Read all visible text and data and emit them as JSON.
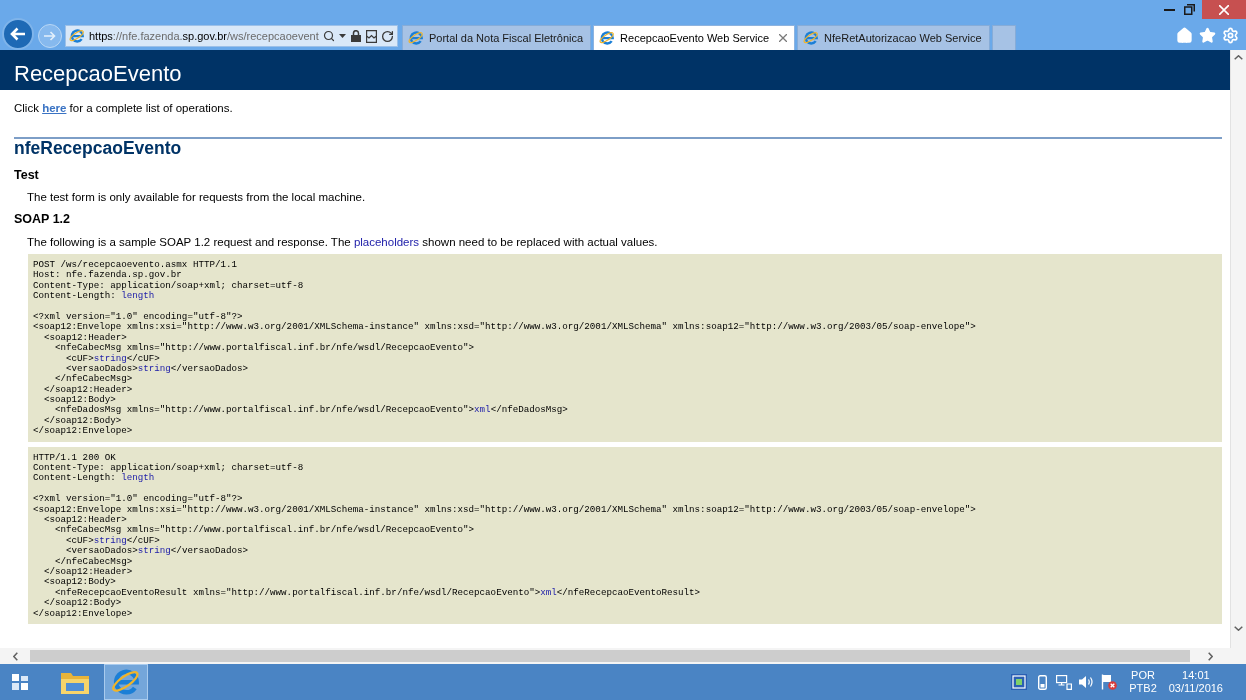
{
  "browser": {
    "address": [
      {
        "text": "https",
        "emphasis": true
      },
      {
        "text": "://nfe.fazenda.",
        "emphasis": false
      },
      {
        "text": "sp.gov.br",
        "emphasis": true
      },
      {
        "text": "/ws/recepcaoevent",
        "emphasis": false
      }
    ],
    "tabs": [
      {
        "label": "Portal da Nota Fiscal Eletrônica",
        "selected": false
      },
      {
        "label": "RecepcaoEvento Web Service",
        "selected": true
      },
      {
        "label": "NfeRetAutorizacao Web Service",
        "selected": false
      }
    ]
  },
  "page": {
    "title": "RecepcaoEvento",
    "operations_note": {
      "before": "Click ",
      "link": "here",
      "after": " for a complete list of operations."
    },
    "operation": "nfeRecepcaoEvento",
    "test": {
      "heading": "Test",
      "note": "The test form is only available for requests from the local machine."
    },
    "soap12": {
      "heading": "SOAP 1.2",
      "note": {
        "before": "The following is a sample SOAP 1.2 request and response. The ",
        "highlight": "placeholders",
        "after": " shown need to be replaced with actual values."
      },
      "samples": [
        {
          "headers": [
            [
              {
                "text": "POST /ws/recepcaoevento.asmx HTTP/1.1",
                "placeholder": false
              }
            ],
            [
              {
                "text": "Host: nfe.fazenda.sp.gov.br",
                "placeholder": false
              }
            ],
            [
              {
                "text": "Content-Type: application/soap+xml; charset=utf-8",
                "placeholder": false
              }
            ],
            [
              {
                "text": "Content-Length: ",
                "placeholder": false
              },
              {
                "text": "length",
                "placeholder": true
              }
            ]
          ],
          "body": [
            [
              {
                "text": "<?xml version=\"1.0\" encoding=\"utf-8\"?>",
                "placeholder": false
              }
            ],
            [
              {
                "text": "<soap12:Envelope xmlns:xsi=\"http://www.w3.org/2001/XMLSchema-instance\" xmlns:xsd=\"http://www.w3.org/2001/XMLSchema\" xmlns:soap12=\"http://www.w3.org/2003/05/soap-envelope\">",
                "placeholder": false
              }
            ],
            [
              {
                "text": "  <soap12:Header>",
                "placeholder": false
              }
            ],
            [
              {
                "text": "    <nfeCabecMsg xmlns=\"http://www.portalfiscal.inf.br/nfe/wsdl/RecepcaoEvento\">",
                "placeholder": false
              }
            ],
            [
              {
                "text": "      <cUF>",
                "placeholder": false
              },
              {
                "text": "string",
                "placeholder": true
              },
              {
                "text": "</cUF>",
                "placeholder": false
              }
            ],
            [
              {
                "text": "      <versaoDados>",
                "placeholder": false
              },
              {
                "text": "string",
                "placeholder": true
              },
              {
                "text": "</versaoDados>",
                "placeholder": false
              }
            ],
            [
              {
                "text": "    </nfeCabecMsg>",
                "placeholder": false
              }
            ],
            [
              {
                "text": "  </soap12:Header>",
                "placeholder": false
              }
            ],
            [
              {
                "text": "  <soap12:Body>",
                "placeholder": false
              }
            ],
            [
              {
                "text": "    <nfeDadosMsg xmlns=\"http://www.portalfiscal.inf.br/nfe/wsdl/RecepcaoEvento\">",
                "placeholder": false
              },
              {
                "text": "xml",
                "placeholder": true
              },
              {
                "text": "</nfeDadosMsg>",
                "placeholder": false
              }
            ],
            [
              {
                "text": "  </soap12:Body>",
                "placeholder": false
              }
            ],
            [
              {
                "text": "</soap12:Envelope>",
                "placeholder": false
              }
            ]
          ]
        },
        {
          "headers": [
            [
              {
                "text": "HTTP/1.1 200 OK",
                "placeholder": false
              }
            ],
            [
              {
                "text": "Content-Type: application/soap+xml; charset=utf-8",
                "placeholder": false
              }
            ],
            [
              {
                "text": "Content-Length: ",
                "placeholder": false
              },
              {
                "text": "length",
                "placeholder": true
              }
            ]
          ],
          "body": [
            [
              {
                "text": "<?xml version=\"1.0\" encoding=\"utf-8\"?>",
                "placeholder": false
              }
            ],
            [
              {
                "text": "<soap12:Envelope xmlns:xsi=\"http://www.w3.org/2001/XMLSchema-instance\" xmlns:xsd=\"http://www.w3.org/2001/XMLSchema\" xmlns:soap12=\"http://www.w3.org/2003/05/soap-envelope\">",
                "placeholder": false
              }
            ],
            [
              {
                "text": "  <soap12:Header>",
                "placeholder": false
              }
            ],
            [
              {
                "text": "    <nfeCabecMsg xmlns=\"http://www.portalfiscal.inf.br/nfe/wsdl/RecepcaoEvento\">",
                "placeholder": false
              }
            ],
            [
              {
                "text": "      <cUF>",
                "placeholder": false
              },
              {
                "text": "string",
                "placeholder": true
              },
              {
                "text": "</cUF>",
                "placeholder": false
              }
            ],
            [
              {
                "text": "      <versaoDados>",
                "placeholder": false
              },
              {
                "text": "string",
                "placeholder": true
              },
              {
                "text": "</versaoDados>",
                "placeholder": false
              }
            ],
            [
              {
                "text": "    </nfeCabecMsg>",
                "placeholder": false
              }
            ],
            [
              {
                "text": "  </soap12:Header>",
                "placeholder": false
              }
            ],
            [
              {
                "text": "  <soap12:Body>",
                "placeholder": false
              }
            ],
            [
              {
                "text": "    <nfeRecepcaoEventoResult xmlns=\"http://www.portalfiscal.inf.br/nfe/wsdl/RecepcaoEvento\">",
                "placeholder": false
              },
              {
                "text": "xml",
                "placeholder": true
              },
              {
                "text": "</nfeRecepcaoEventoResult>",
                "placeholder": false
              }
            ],
            [
              {
                "text": "  </soap12:Body>",
                "placeholder": false
              }
            ],
            [
              {
                "text": "</soap12:Envelope>",
                "placeholder": false
              }
            ]
          ]
        }
      ]
    }
  },
  "taskbar": {
    "language": "POR",
    "layout": "PTB2",
    "time": "14:01",
    "date": "03/11/2016"
  }
}
